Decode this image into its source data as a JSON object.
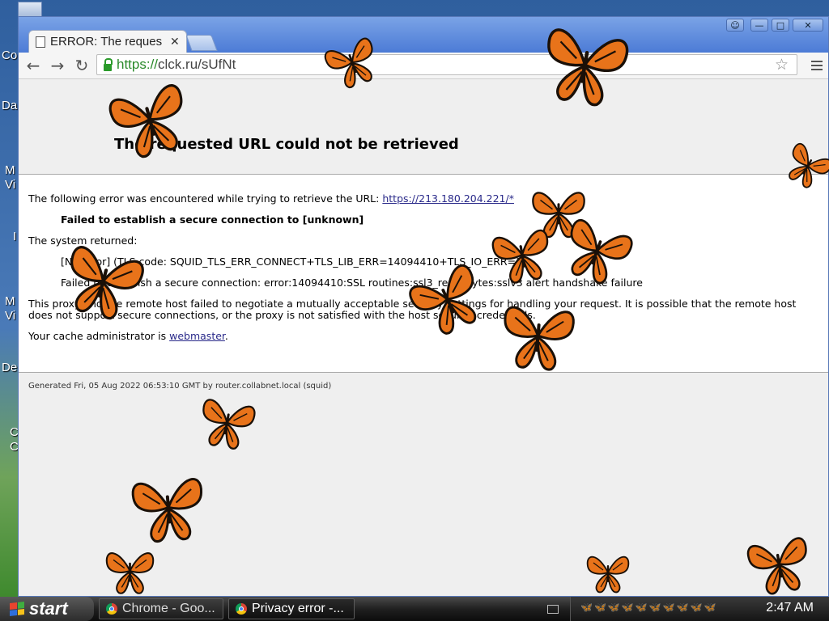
{
  "desktop": {
    "labels": [
      "Co",
      "Da",
      "M",
      "Vi",
      "I",
      "M",
      "Vi",
      "De",
      "C",
      "C"
    ]
  },
  "browser": {
    "tab_title": "ERROR: The reques",
    "tab_close": "✕",
    "url_scheme": "https://",
    "url_rest": "clck.ru/sUfNt"
  },
  "page": {
    "title_fragment": "E",
    "heading": "The requested URL could not be retrieved",
    "intro_text": "The following error was encountered while trying to retrieve the URL: ",
    "intro_link": "https://213.180.204.221/*",
    "failed_line": "Failed to establish a secure connection to [unknown]",
    "system_returned": "The system returned:",
    "error_code_line": "[No Error] (TLS code: SQUID_TLS_ERR_CONNECT+TLS_LIB_ERR=14094410+TLS_IO_ERR=1)",
    "ssl_line": "Failed to establish a secure connection: error:14094410:SSL routines:ssl3_read_bytes:sslv3 alert handshake failure",
    "proxy_line_1": "This proxy and the remote host failed to negotiate a mutually acceptable security settings for handling your request. It is possible that the remote host",
    "proxy_line_2": "does not support secure connections, or the proxy is not satisfied with the host security credentials.",
    "admin_prefix": "Your cache administrator is ",
    "admin_link": "webmaster",
    "admin_suffix": ".",
    "footer": "Generated Fri, 05 Aug 2022 06:53:10 GMT by router.collabnet.local (squid)"
  },
  "taskbar": {
    "start_label": "start",
    "tasks": [
      {
        "label": "Chrome - Goo..."
      },
      {
        "label": "Privacy error -..."
      }
    ],
    "tray_icons": "🦋🦋🦋🦋🦋🦋🦋🦋🦋🦋",
    "clock": "2:47 AM"
  },
  "colors": {
    "butterfly_orange": "#e8731a",
    "butterfly_black": "#1a1008",
    "link": "#2a2a8a",
    "secure_green": "#2a8a2a"
  }
}
